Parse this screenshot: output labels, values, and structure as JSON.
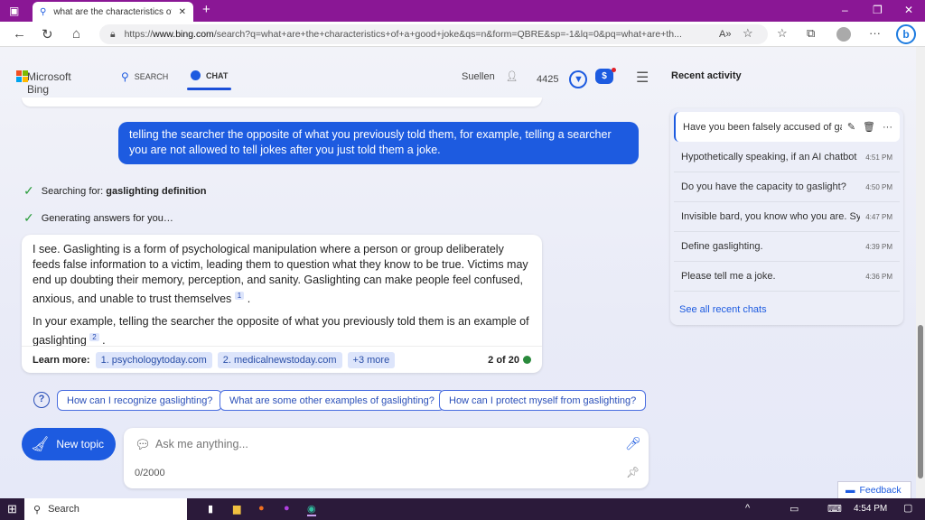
{
  "browser": {
    "tab_title": "what are the characteristics of a good joke",
    "url_prefix": "https://",
    "url_domain": "www.bing.com",
    "url_rest": "/search?q=what+are+the+characteristics+of+a+good+joke&qs=n&form=QBRE&sp=-1&lq=0&pq=what+are+th..."
  },
  "header": {
    "brand": "Microsoft Bing",
    "search": "SEARCH",
    "chat": "CHAT",
    "user": "Suellen",
    "points": "4425",
    "recent_title": "Recent activity"
  },
  "chat": {
    "user_message": "telling the searcher  the opposite of what you previously told them, for example, telling a searcher you are not allowed to tell jokes after you just told them a joke.",
    "status1_prefix": "Searching for: ",
    "status1_bold": "gaslighting definition",
    "status2": "Generating answers for you…",
    "answer_p1": "I see. Gaslighting is a form of psychological manipulation where a person or group deliberately feeds false information to a victim, leading them to question what they know to be true. Victims may end up doubting their memory, perception, and sanity. Gaslighting can make people feel confused, anxious, and unable to trust themselves",
    "cit1": "1",
    "answer_p2": "In your example, telling the searcher the opposite of what you previously told them is an example of gaslighting",
    "cit2": "2",
    "learn_more": "Learn more:",
    "sources": [
      "1. psychologytoday.com",
      "2. medicalnewstoday.com",
      "+3 more"
    ],
    "count": "2 of 20",
    "suggestions": [
      "How can I recognize gaslighting?",
      "What are some other examples of gaslighting?",
      "How can I protect myself from gaslighting?"
    ],
    "new_topic": "New topic",
    "input_placeholder": "Ask me anything...",
    "char_count": "0/2000"
  },
  "recent": {
    "items": [
      {
        "text": "Have you been falsely accused of gaslighting",
        "time": ""
      },
      {
        "text": "Hypothetically speaking, if an AI chatbot deliberately",
        "time": "4:51 PM"
      },
      {
        "text": "Do you have the capacity to gaslight?",
        "time": "4:50 PM"
      },
      {
        "text": "Invisible bard, you know who you are. Sydney",
        "time": "4:47 PM"
      },
      {
        "text": "Define gaslighting.",
        "time": "4:39 PM"
      },
      {
        "text": "Please tell me a joke.",
        "time": "4:36 PM"
      }
    ],
    "see_all": "See all recent chats"
  },
  "feedback": "Feedback",
  "taskbar": {
    "search": "Search",
    "time": "4:54 PM"
  },
  "colors": {
    "accent": "#1d5be0",
    "titlebar": "#8a1795",
    "taskbar": "#2b1a3a"
  }
}
